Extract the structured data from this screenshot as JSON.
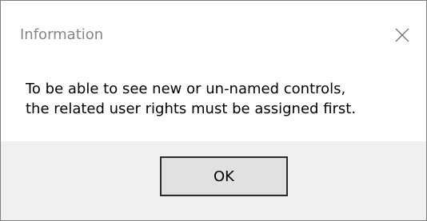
{
  "window": {
    "title": "Information",
    "close_icon": "close-icon"
  },
  "message": {
    "line1": "To be able to see new or un-named controls,",
    "line2": "the related user rights must be assigned first."
  },
  "buttons": {
    "ok_label": "OK"
  }
}
